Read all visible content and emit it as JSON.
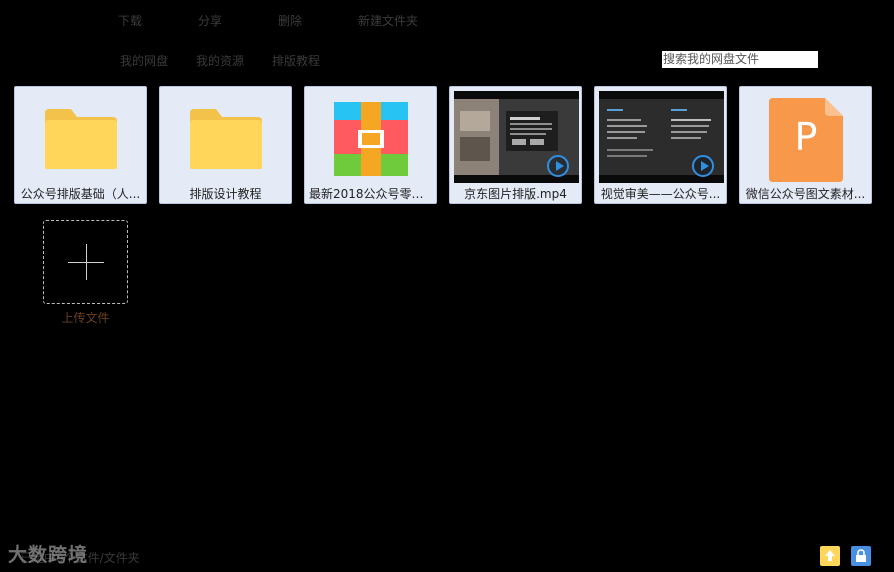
{
  "toolbar": {
    "download": "下载",
    "share": "分享",
    "delete": "删除",
    "new_folder": "新建文件夹"
  },
  "nav": {
    "my_disk": "我的网盘",
    "my_resources": "我的资源",
    "layout_tutorial": "排版教程"
  },
  "search": {
    "placeholder": "搜索我的网盘文件"
  },
  "files": [
    {
      "name": "公众号排版基础（人...",
      "type": "folder"
    },
    {
      "name": "排版设计教程",
      "type": "folder"
    },
    {
      "name": "最新2018公众号零基...",
      "type": "archive"
    },
    {
      "name": "京东图片排版.mp4",
      "type": "video"
    },
    {
      "name": "视觉审美——公众号...",
      "type": "video"
    },
    {
      "name": "微信公众号图文素材...",
      "type": "ppt",
      "icon_letter": "P"
    }
  ],
  "upload": {
    "label": "上传文件"
  },
  "status": {
    "text": "已选中0个文件/文件夹"
  },
  "watermark": {
    "text": "大数跨境"
  },
  "colors": {
    "folder": "#ffd55a",
    "ppt": "#f7984a",
    "play": "#2f8fe0",
    "tile_bg": "#e4ebf7",
    "upload_label": "#6b3f1f"
  }
}
